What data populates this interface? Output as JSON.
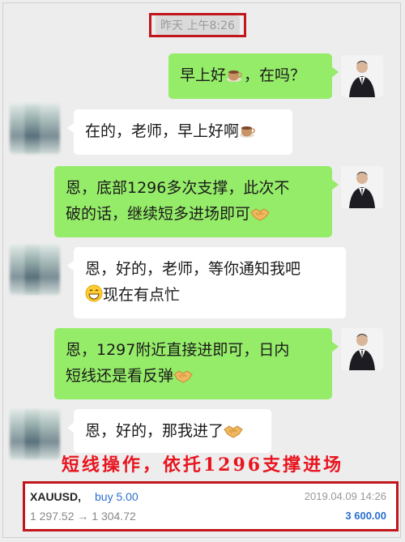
{
  "timestamp": "昨天 上午8:26",
  "messages": [
    {
      "side": "me",
      "text": "早上好",
      "emoji": "coffee-icon",
      "text_after": "，在吗？"
    },
    {
      "side": "other",
      "text": "在的，老师，早上好啊",
      "emoji": "coffee-icon"
    },
    {
      "side": "me",
      "line1": "恩，底部1296多次支撑，此次不",
      "line2": "破的话，继续短多进场即可",
      "emoji": "handshake-icon"
    },
    {
      "side": "other",
      "line1": "恩，好的，老师，等你通知我吧",
      "emoji_leading": "grin-icon",
      "line2": "现在有点忙"
    },
    {
      "side": "me",
      "line1": "恩，1297附近直接进即可，日内",
      "line2": "短线还是看反弹",
      "emoji": "handshake-icon"
    },
    {
      "side": "other",
      "text": "恩，好的，那我进了",
      "emoji": "handshake-icon"
    }
  ],
  "caption": "短线操作，依托1296支撑进场",
  "trade": {
    "symbol": "XAUUSD,",
    "action": "buy 5.00",
    "date": "2019.04.09 14:26",
    "prices": "1 297.52 → 1 304.72",
    "profit": "3 600.00"
  },
  "colors": {
    "my_bubble": "#95ec69",
    "other_bubble": "#ffffff",
    "highlight_border": "#c0161c",
    "caption": "#e8151f",
    "trade_blue": "#2a6fcf"
  }
}
